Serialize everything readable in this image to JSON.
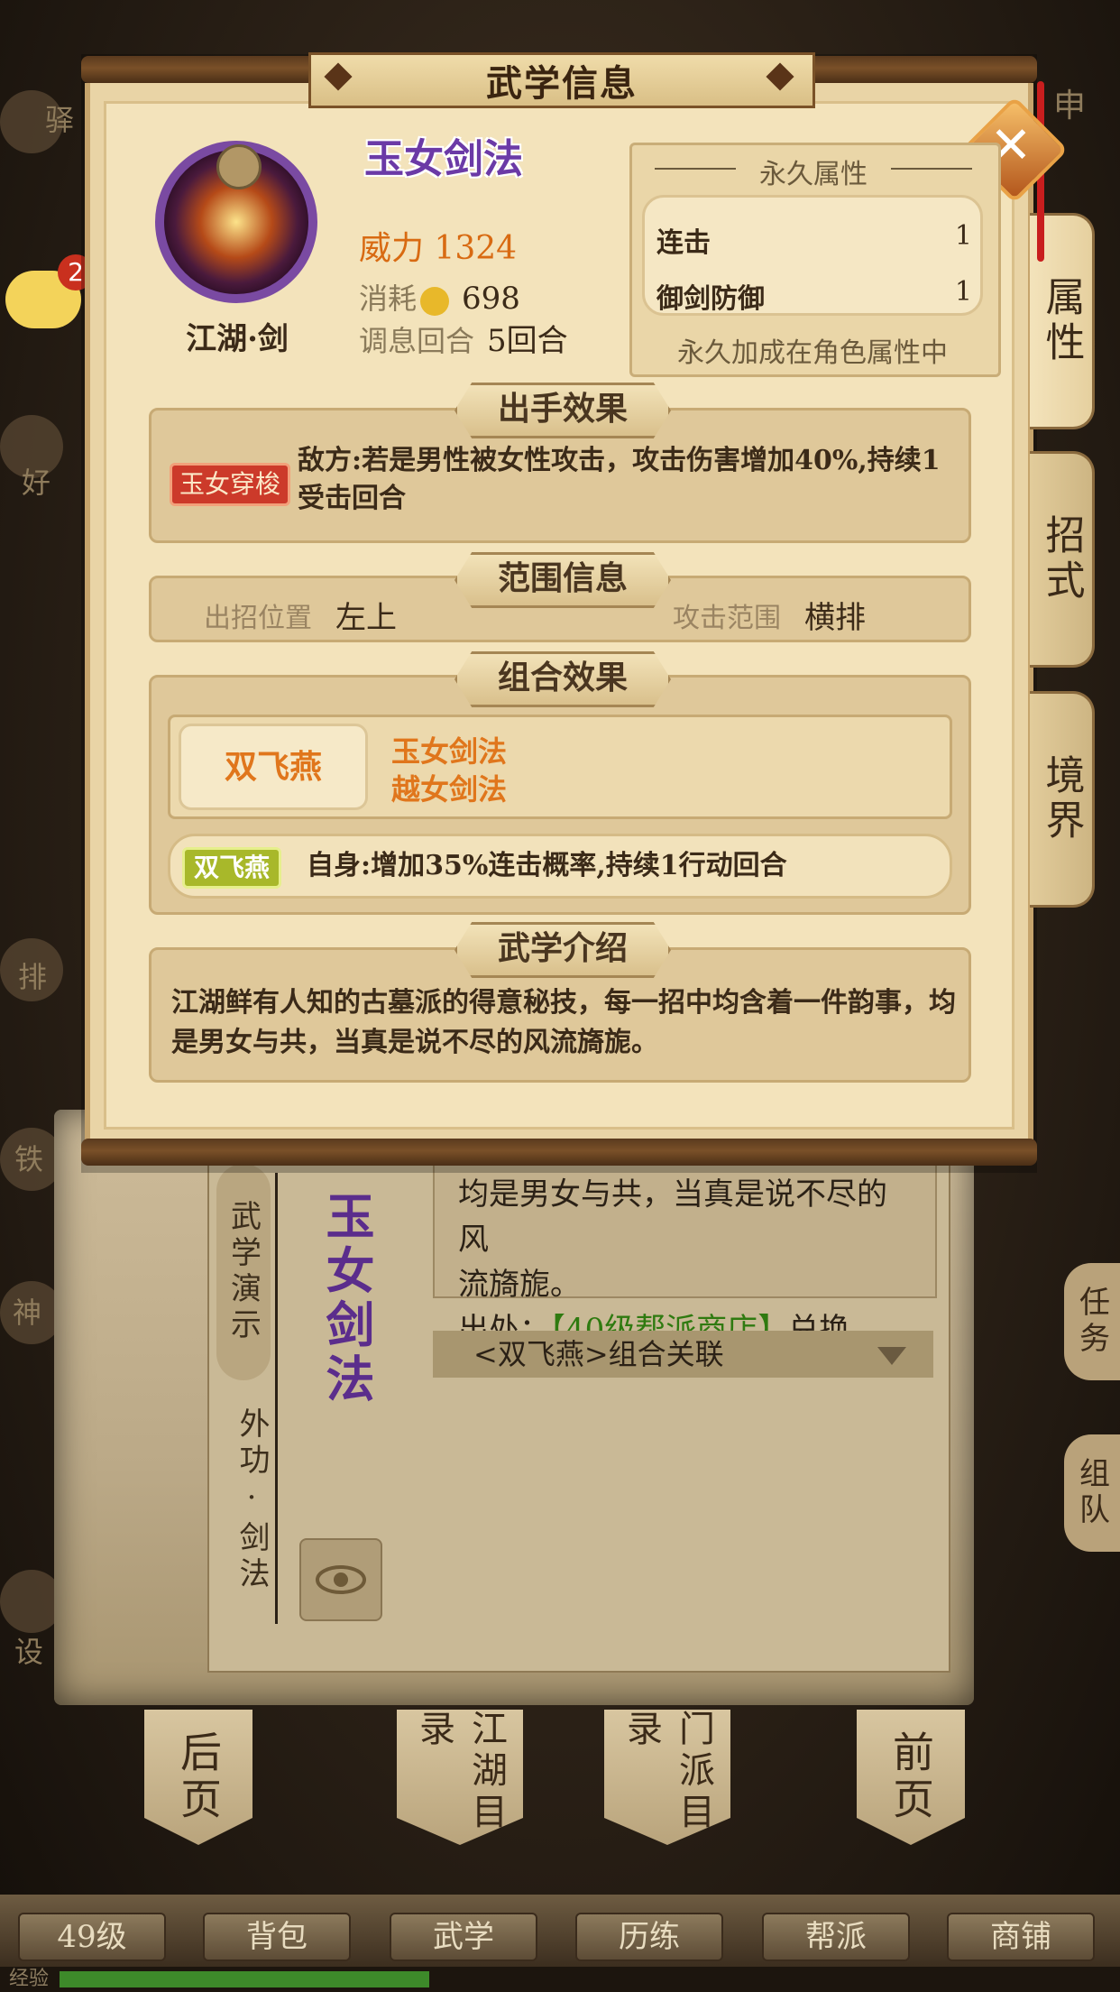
{
  "background": {
    "left_icons": [
      "驿",
      "好",
      "排",
      "铁",
      "神",
      "设"
    ],
    "right_top_label": "申",
    "chat_badge_count": "2",
    "right_side": {
      "task": "任务",
      "team": "组队"
    },
    "book": {
      "demo_label": "武学演示",
      "skill_type": "外功·剑法",
      "skill_name": "玉女剑法",
      "desc_line1": "均是男女与共，当真是说不尽的风",
      "desc_line2": "流旖旎。",
      "source_prefix": "出处：",
      "source_link": "【40级帮派商店】",
      "source_suffix": "兑换",
      "combo_link": "<双飞燕>组合关联",
      "eye_icon": "eye-icon"
    },
    "banners": [
      "后页",
      "江湖目录",
      "门派目录",
      "前页"
    ],
    "nav": [
      "49级",
      "背包",
      "武学",
      "历练",
      "帮派",
      "商铺"
    ],
    "exp_label": "经验",
    "exp_progress": 0.35
  },
  "dialog": {
    "title": "武学信息",
    "close_icon": "close-icon",
    "tabs": [
      {
        "label": "属性",
        "active": true
      },
      {
        "label": "招式",
        "active": false
      },
      {
        "label": "境界",
        "active": false
      }
    ],
    "avatar_label": "江湖·剑",
    "skill_name": "玉女剑法",
    "power_label": "威力",
    "power_value": "1324",
    "cost_label": "消耗",
    "cost_icon": "coin-icon",
    "cost_value": "698",
    "recover_label": "调息回合",
    "recover_value": "5回合",
    "permanent": {
      "title": "永久属性",
      "rows": [
        {
          "name": "连击",
          "value": "1"
        },
        {
          "name": "御剑防御",
          "value": "1"
        }
      ],
      "footer": "永久加成在角色属性中"
    },
    "effect": {
      "title": "出手效果",
      "tag": "玉女穿梭",
      "text": "敌方:若是男性被女性攻击，攻击伤害增加40%,持续1受击回合"
    },
    "range": {
      "title": "范围信息",
      "position_label": "出招位置",
      "position_value": "左上",
      "area_label": "攻击范围",
      "area_value": "横排"
    },
    "combo": {
      "title": "组合效果",
      "badge": "双飞燕",
      "skills": [
        "玉女剑法",
        "越女剑法"
      ],
      "tag": "双飞燕",
      "effect_text": "自身:增加35%连击概率,持续1行动回合"
    },
    "intro": {
      "title": "武学介绍",
      "text": "江湖鲜有人知的古墓派的得意秘技，每一招中均含着一件韵事，均是男女与共，当真是说不尽的风流旖旎。"
    },
    "colors": {
      "accent_orange": "#e0761c",
      "skill_purple": "#6b3aa6",
      "tag_red": "#cc3a2a",
      "tag_green": "#a8b82a"
    }
  }
}
